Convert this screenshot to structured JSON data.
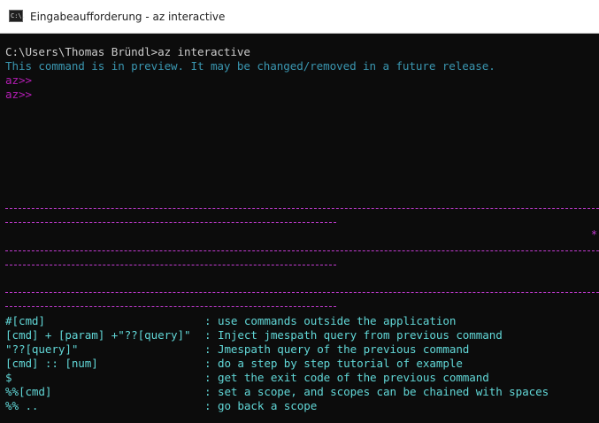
{
  "window": {
    "title": "Eingabeaufforderung - az  interactive",
    "icon": "C:\\."
  },
  "console": {
    "prompt_line": "C:\\Users\\Thomas Bründl>az interactive",
    "preview_warning": "This command is in preview. It may be changed/removed in a future release.",
    "az_prompt_1": "az>>",
    "az_prompt_2": "az>>",
    "star": "*"
  },
  "help": [
    {
      "key": "#[cmd]",
      "sep": ":",
      "desc": "use commands outside the application"
    },
    {
      "key": "[cmd] + [param] +\"??[query]\"",
      "sep": ":",
      "desc": "Inject jmespath query from previous command"
    },
    {
      "key": "\"??[query]\"",
      "sep": ":",
      "desc": "Jmespath query of the previous command"
    },
    {
      "key": "[cmd] :: [num]",
      "sep": ":",
      "desc": "do a step by step tutorial of example"
    },
    {
      "key": "$",
      "sep": ":",
      "desc": "get the exit code of the previous command"
    },
    {
      "key": "%%[cmd]",
      "sep": ":",
      "desc": "set a scope, and scopes can be chained with spaces"
    },
    {
      "key": "%% ..",
      "sep": ":",
      "desc": "go back a scope"
    }
  ],
  "colors": {
    "background": "#0c0c0c",
    "text": "#cccccc",
    "preview": "#3a96b0",
    "prompt": "#b41db4",
    "help": "#61d6d6",
    "divider": "#c23bd0"
  }
}
